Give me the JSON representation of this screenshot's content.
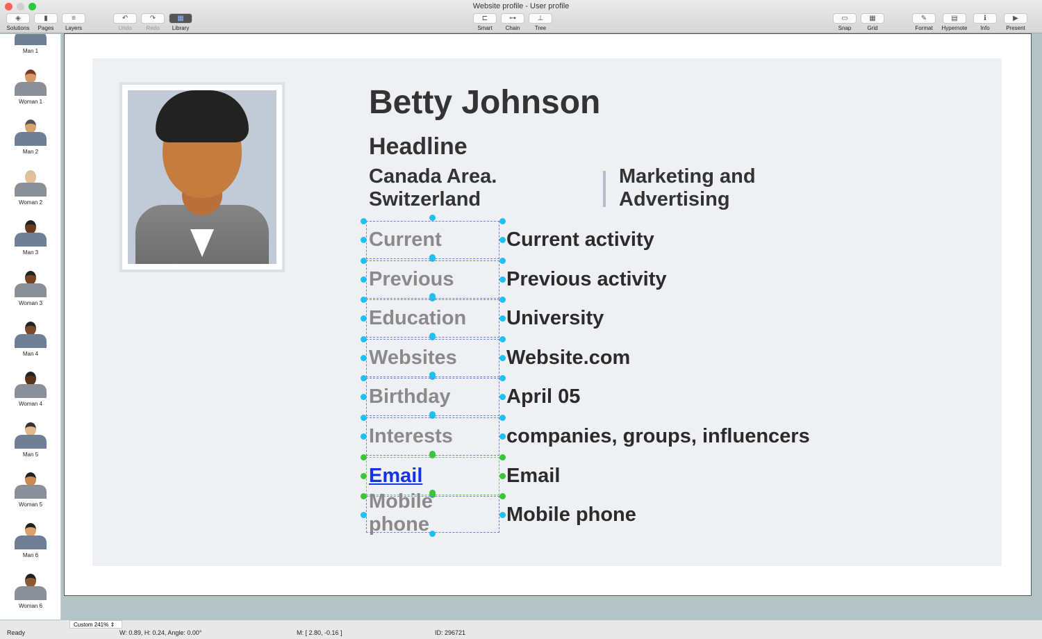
{
  "window": {
    "title": "Website profile - User profile"
  },
  "toolbar": {
    "left": [
      {
        "label": "Solutions",
        "icon": "solutions-icon",
        "g": "◈"
      },
      {
        "label": "Pages",
        "icon": "pages-icon",
        "g": "▮"
      },
      {
        "label": "Layers",
        "icon": "layers-icon",
        "g": "≡"
      }
    ],
    "history": [
      {
        "label": "Undo",
        "icon": "undo-icon",
        "g": "↶"
      },
      {
        "label": "Redo",
        "icon": "redo-icon",
        "g": "↷"
      },
      {
        "label": "Library",
        "icon": "library-icon",
        "g": "▦"
      }
    ],
    "center": [
      {
        "label": "Smart",
        "icon": "smart-connector-icon",
        "g": "⊏"
      },
      {
        "label": "Chain",
        "icon": "chain-icon",
        "g": "⊶"
      },
      {
        "label": "Tree",
        "icon": "tree-icon",
        "g": "⊥"
      }
    ],
    "snapgrid": [
      {
        "label": "Snap",
        "icon": "snap-icon",
        "g": "▭"
      },
      {
        "label": "Grid",
        "icon": "grid-icon",
        "g": "▦"
      }
    ],
    "right": [
      {
        "label": "Format",
        "icon": "format-icon",
        "g": "✎"
      },
      {
        "label": "Hypernote",
        "icon": "hypernote-icon",
        "g": "▤"
      },
      {
        "label": "Info",
        "icon": "info-icon",
        "g": "ℹ"
      },
      {
        "label": "Present",
        "icon": "present-icon",
        "g": "▶"
      }
    ]
  },
  "library": [
    "Man 1",
    "Woman 1",
    "Man 2",
    "Woman 2",
    "Man 3",
    "Woman 3",
    "Man 4",
    "Woman 4",
    "Man 5",
    "Woman 5",
    "Man 6",
    "Woman 6"
  ],
  "profile": {
    "name": "Betty Johnson",
    "headline": "Headline",
    "location": "Canada Area. Switzerland",
    "industry": "Marketing and Advertising",
    "rows": [
      {
        "label": "Current",
        "value": "Current activity"
      },
      {
        "label": "Previous",
        "value": "Previous activity"
      },
      {
        "label": "Education",
        "value": "University"
      },
      {
        "label": "Websites",
        "value": "Website.com"
      },
      {
        "label": "Birthday",
        "value": "April 05"
      },
      {
        "label": "Interests",
        "value": "companies, groups, influencers"
      },
      {
        "label": "Email",
        "value": "Email"
      },
      {
        "label": "Mobile phone",
        "value": "Mobile phone"
      }
    ]
  },
  "status": {
    "ready": "Ready",
    "zoom": "Custom 241%",
    "size": "W: 0.89,  H: 0.24,  Angle: 0.00°",
    "mouse": "M: [ 2.80, -0.16 ]",
    "id": "ID: 296721"
  }
}
